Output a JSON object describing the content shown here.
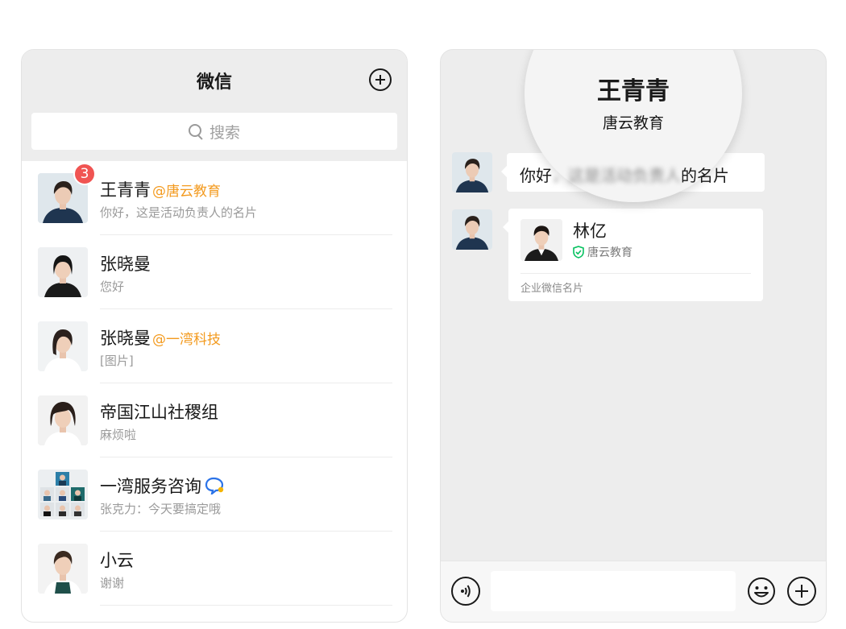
{
  "left_panel": {
    "title": "微信",
    "search_placeholder": "搜索",
    "chats": [
      {
        "name": "王青青",
        "corp": "@唐云教育",
        "preview": "你好，这是活动负责人的名片",
        "unread": "3",
        "avatar": "avatar-woman-navy"
      },
      {
        "name": "张晓曼",
        "corp": "",
        "preview": "您好",
        "unread": "",
        "avatar": "avatar-woman-black"
      },
      {
        "name": "张晓曼",
        "corp": "@一湾科技",
        "preview": "[图片]",
        "unread": "",
        "avatar": "avatar-woman-white"
      },
      {
        "name": "帝国江山社稷组",
        "corp": "",
        "preview": "麻烦啦",
        "unread": "",
        "avatar": "avatar-woman-bob"
      },
      {
        "name": "一湾服务咨询",
        "corp": "",
        "preview": "张克力：今天要搞定哦",
        "unread": "",
        "avatar": "group-avatar-grid"
      },
      {
        "name": "小云",
        "corp": "",
        "preview": "谢谢",
        "unread": "",
        "avatar": "avatar-woman-apron"
      }
    ]
  },
  "right_panel": {
    "title": "王青青",
    "subtitle": "唐云教育",
    "messages": [
      {
        "type": "text",
        "text_clear_start": "你好",
        "text_blurred": "，这是活动负责人",
        "text_clear_end": "的名片"
      },
      {
        "type": "card",
        "name": "林亿",
        "corp": "唐云教育",
        "label": "企业微信名片"
      }
    ]
  },
  "colors": {
    "badge": "#f05452",
    "corp_tag": "#f39a1e",
    "verified": "#07c160",
    "panel_bg": "#ededed"
  }
}
